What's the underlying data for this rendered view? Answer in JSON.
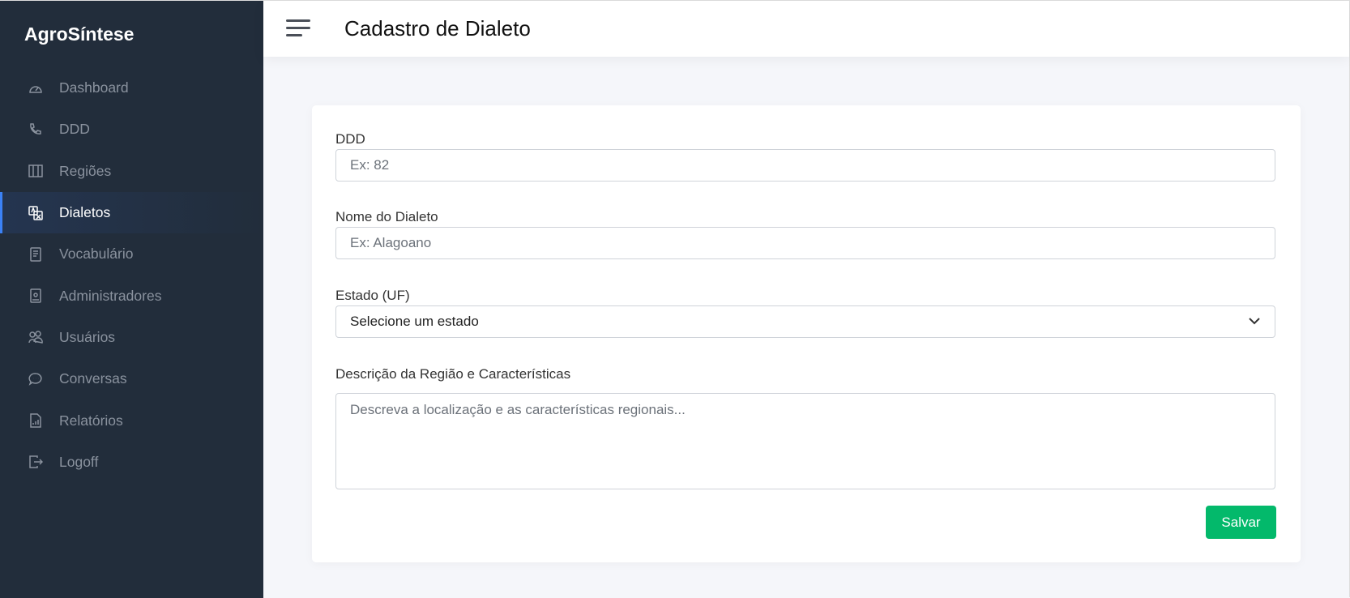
{
  "app": {
    "name": "AgroSíntese"
  },
  "sidebar": {
    "items": [
      {
        "label": "Dashboard",
        "icon": "speedometer-icon"
      },
      {
        "label": "DDD",
        "icon": "phone-icon"
      },
      {
        "label": "Regiões",
        "icon": "map-icon"
      },
      {
        "label": "Dialetos",
        "icon": "translate-icon",
        "active": true
      },
      {
        "label": "Vocabulário",
        "icon": "journal-icon"
      },
      {
        "label": "Administradores",
        "icon": "badge-icon"
      },
      {
        "label": "Usuários",
        "icon": "people-icon"
      },
      {
        "label": "Conversas",
        "icon": "chat-icon"
      },
      {
        "label": "Relatórios",
        "icon": "report-icon"
      },
      {
        "label": "Logoff",
        "icon": "logout-icon"
      }
    ]
  },
  "header": {
    "title": "Cadastro de Dialeto"
  },
  "form": {
    "ddd": {
      "label": "DDD",
      "placeholder": "Ex: 82"
    },
    "nome": {
      "label": "Nome do Dialeto",
      "placeholder": "Ex: Alagoano"
    },
    "estado": {
      "label": "Estado (UF)",
      "value": "Selecione um estado"
    },
    "descricao": {
      "label": "Descrição da Região e Características",
      "placeholder": "Descreva a localização e as características regionais..."
    },
    "save_label": "Salvar"
  },
  "colors": {
    "sidebar": "#222d3b",
    "accent": "#3b82f6",
    "save": "#03b96b"
  }
}
